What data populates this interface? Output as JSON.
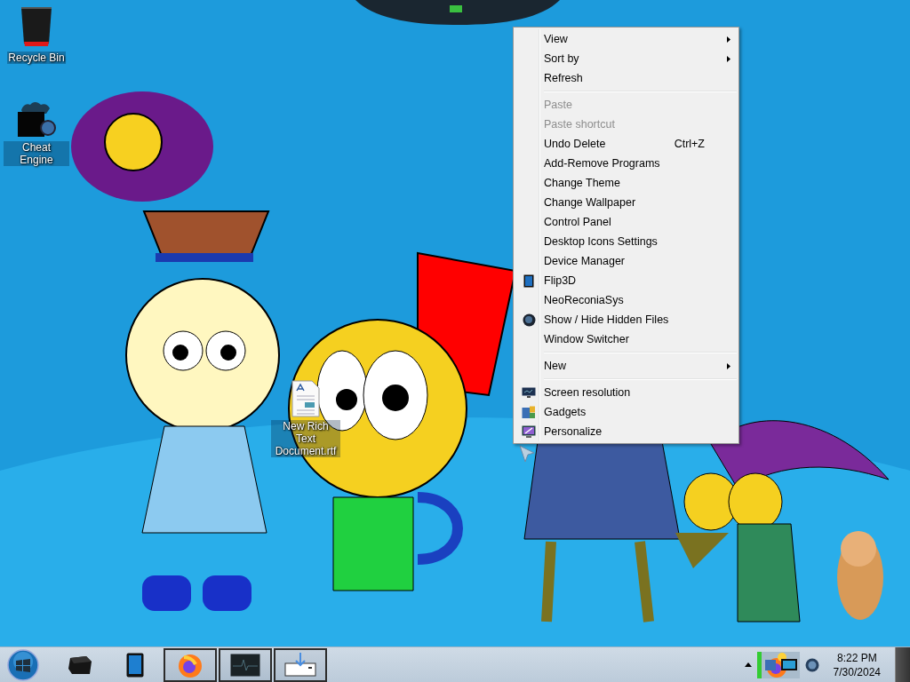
{
  "desktop_icons": [
    {
      "label": "Recycle Bin",
      "selected": false
    },
    {
      "label": "Cheat Engine",
      "selected": false
    },
    {
      "label": "New Rich Text Document.rtf",
      "selected": false
    }
  ],
  "context_menu": {
    "items": [
      {
        "kind": "item",
        "label": "View",
        "disabled": false,
        "submenu": true
      },
      {
        "kind": "item",
        "label": "Sort by",
        "disabled": false,
        "submenu": true
      },
      {
        "kind": "item",
        "label": "Refresh",
        "disabled": false,
        "submenu": false
      },
      {
        "kind": "separator"
      },
      {
        "kind": "item",
        "label": "Paste",
        "disabled": true,
        "submenu": false
      },
      {
        "kind": "item",
        "label": "Paste shortcut",
        "disabled": true,
        "submenu": false
      },
      {
        "kind": "item",
        "label": "Undo Delete",
        "shortcut": "Ctrl+Z",
        "disabled": false,
        "submenu": false
      },
      {
        "kind": "item",
        "label": "Add-Remove Programs",
        "disabled": false,
        "submenu": false
      },
      {
        "kind": "item",
        "label": "Change Theme",
        "disabled": false,
        "submenu": false
      },
      {
        "kind": "item",
        "label": "Change Wallpaper",
        "disabled": false,
        "submenu": false
      },
      {
        "kind": "item",
        "label": "Control Panel",
        "disabled": false,
        "submenu": false
      },
      {
        "kind": "item",
        "label": "Desktop Icons Settings",
        "disabled": false,
        "submenu": false
      },
      {
        "kind": "item",
        "label": "Device Manager",
        "disabled": false,
        "submenu": false
      },
      {
        "kind": "item",
        "label": "Flip3D",
        "disabled": false,
        "submenu": false
      },
      {
        "kind": "item",
        "label": "NeoReconiaSys",
        "disabled": false,
        "submenu": false
      },
      {
        "kind": "item",
        "label": "Show / Hide Hidden Files",
        "disabled": false,
        "submenu": false
      },
      {
        "kind": "item",
        "label": "Window Switcher",
        "disabled": false,
        "submenu": false
      },
      {
        "kind": "separator"
      },
      {
        "kind": "item",
        "label": "New",
        "disabled": false,
        "submenu": true
      },
      {
        "kind": "separator"
      },
      {
        "kind": "item",
        "label": "Screen resolution",
        "disabled": false,
        "submenu": false
      },
      {
        "kind": "item",
        "label": "Gadgets",
        "disabled": false,
        "submenu": false
      },
      {
        "kind": "item",
        "label": "Personalize",
        "disabled": false,
        "submenu": false
      }
    ]
  },
  "taskbar": {
    "buttons": [
      {
        "running": false
      },
      {
        "running": false
      },
      {
        "running": true
      },
      {
        "running": true
      },
      {
        "running": true
      }
    ],
    "clock": {
      "time": "8:22 PM",
      "date": "7/30/2024"
    }
  }
}
